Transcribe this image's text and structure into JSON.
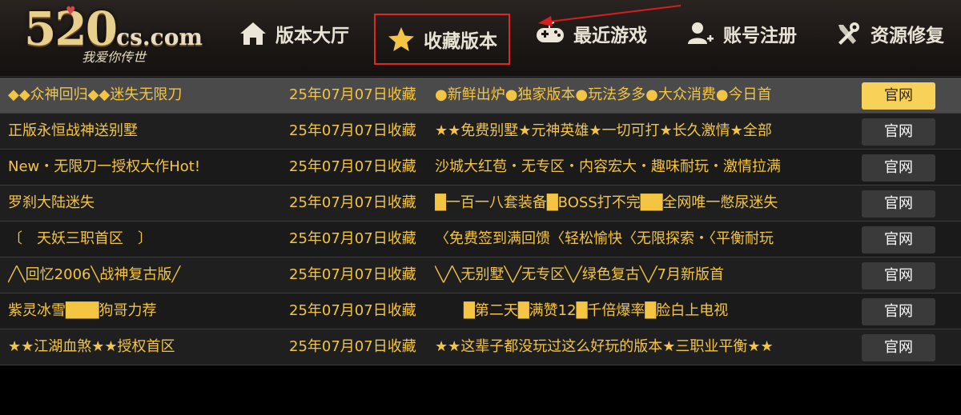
{
  "logo": {
    "main": "520",
    "suffix": "cs.com",
    "tagline": "我爱你传世"
  },
  "nav": [
    {
      "label": "版本大厅",
      "icon": "home-icon"
    },
    {
      "label": "收藏版本",
      "icon": "star-icon",
      "active": true
    },
    {
      "label": "最近游戏",
      "icon": "gamepad-icon"
    },
    {
      "label": "账号注册",
      "icon": "add-user-icon"
    },
    {
      "label": "资源修复",
      "icon": "tools-icon"
    }
  ],
  "rows": [
    {
      "name": "◆◆众神回归◆◆迷失无限刀",
      "date": "25年07月07日收藏",
      "desc": "●新鲜出炉●独家版本●玩法多多●大众消费●今日首",
      "button": "官网"
    },
    {
      "name": "正版永恒战神送别墅",
      "date": "25年07月07日收藏",
      "desc": "★★免费别墅★元神英雄★一切可打★长久激情★全部",
      "button": "官网"
    },
    {
      "name": "New・无限刀一授权大作Hot!",
      "date": "25年07月07日收藏",
      "desc": "沙城大红苞・无专区・内容宏大・趣味耐玩・激情拉满",
      "button": "官网"
    },
    {
      "name": "罗刹大陆迷失",
      "date": "25年07月07日收藏",
      "desc": "█一百一八套装备█BOSS打不完██全网唯一憋尿迷失",
      "button": "官网"
    },
    {
      "name": "〔　天妖三职首区　〕",
      "date": "25年07月07日收藏",
      "desc": "〈免费签到满回馈〈轻松愉快〈无限探索・〈平衡耐玩",
      "button": "官网"
    },
    {
      "name": "╱╲回忆2006╲战神复古版╱",
      "date": "25年07月07日收藏",
      "desc": "╲╱╲无别墅╲╱无专区╲╱绿色复古╲╱7月新版首",
      "button": "官网"
    },
    {
      "name": "紫灵冰雪███狗哥力荐",
      "date": "25年07月07日收藏",
      "desc": "　　█第二天█满赞12█千倍爆率█脸白上电视",
      "button": "官网"
    },
    {
      "name": "★★江湖血煞★★授权首区",
      "date": "25年07月07日收藏",
      "desc": "★★这辈子都没玩过这么好玩的版本★三职业平衡★★",
      "button": "官网"
    }
  ],
  "colors": {
    "accent": "#f4c542",
    "button_active": "#f8d159",
    "highlight_box": "#e3271f"
  }
}
